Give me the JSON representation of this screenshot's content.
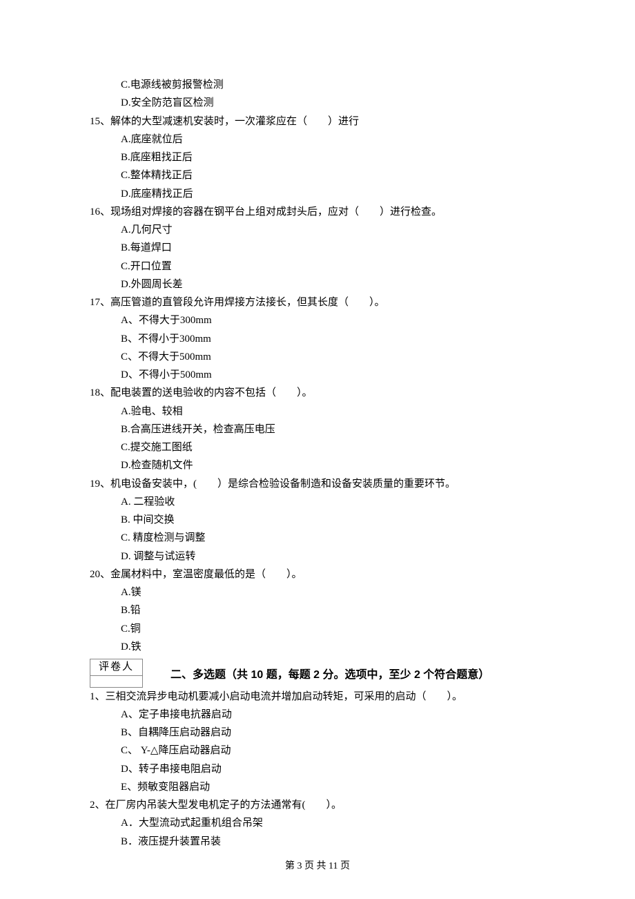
{
  "q14_continued": {
    "options": {
      "c": "C.电源线被剪报警检测",
      "d": "D.安全防范盲区检测"
    }
  },
  "q15": {
    "stem": "15、解体的大型减速机安装时，一次灌浆应在（　　）进行",
    "options": {
      "a": "A.底座就位后",
      "b": "B.底座粗找正后",
      "c": "C.整体精找正后",
      "d": "D.底座精找正后"
    }
  },
  "q16": {
    "stem": "16、现场组对焊接的容器在钢平台上组对成封头后，应对（　　）进行检查。",
    "options": {
      "a": "A.几何尺寸",
      "b": "B.每道焊口",
      "c": "C.开口位置",
      "d": "D.外圆周长差"
    }
  },
  "q17": {
    "stem": "17、高压管道的直管段允许用焊接方法接长，但其长度（　　）。",
    "options": {
      "a": "A、不得大于300mm",
      "b": "B、不得小于300mm",
      "c": "C、不得大于500mm",
      "d": "D、不得小于500mm"
    }
  },
  "q18": {
    "stem": "18、配电装置的送电验收的内容不包括（　　）。",
    "options": {
      "a": "A.验电、较相",
      "b": "B.合高压进线开关，检查高压电压",
      "c": "C.提交施工图纸",
      "d": "D.检查随机文件"
    }
  },
  "q19": {
    "stem": "19、机电设备安装中，(　　）是综合检验设备制造和设备安装质量的重要环节。",
    "options": {
      "a": "A.  二程验收",
      "b": "B.  中间交换",
      "c": "C.  精度检测与调整",
      "d": "D.  调整与试运转"
    }
  },
  "q20": {
    "stem": "20、金属材料中，室温密度最低的是（　　）。",
    "options": {
      "a": "A.镁",
      "b": "B.铅",
      "c": "C.铜",
      "d": "D.铁"
    }
  },
  "grader_label": "评卷人",
  "section2_heading": "二、多选题（共 10 题，每题 2 分。选项中，至少 2 个符合题意）",
  "mq1": {
    "stem": "1、三相交流异步电动机要减小启动电流并增加启动转矩，可采用的启动（　　）。",
    "options": {
      "a": "A、定子串接电抗器启动",
      "b": "B、自耦降压启动器启动",
      "c": "C、 Y-△降压启动器启动",
      "d": "D、转子串接电阻启动",
      "e": "E、频敏变阻器启动"
    }
  },
  "mq2": {
    "stem": "2、在厂房内吊装大型发电机定子的方法通常有(　　）。",
    "options": {
      "a": "A．大型流动式起重机组合吊架",
      "b": "B．液压提升装置吊装"
    }
  },
  "footer": "第 3 页 共 11 页"
}
